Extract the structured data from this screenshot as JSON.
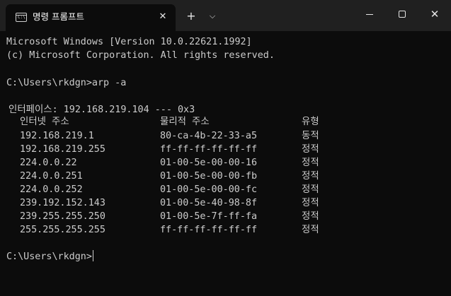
{
  "window": {
    "tab_title": "명령 프롬프트",
    "tab_close_glyph": "✕",
    "new_tab_glyph": "+",
    "dropdown_glyph": "⌵",
    "tab_icon_prompt": "C:\\",
    "close_glyph": "✕",
    "icons": [
      "console-app-icon",
      "close-icon",
      "plus-icon",
      "chevron-down-icon",
      "minimize-icon",
      "maximize-icon",
      "close-icon"
    ]
  },
  "terminal": {
    "header_line1": "Microsoft Windows [Version 10.0.22621.1992]",
    "header_line2": "(c) Microsoft Corporation. All rights reserved.",
    "command_line": "C:\\Users\\rkdgn>arp -a",
    "interface_line": "인터페이스: 192.168.219.104 --- 0x3",
    "columns": {
      "ip": "인터넷 주소",
      "mac": "물리적 주소",
      "type": "유형"
    },
    "rows": [
      {
        "ip": "192.168.219.1",
        "mac": "80-ca-4b-22-33-a5",
        "type": "동적"
      },
      {
        "ip": "192.168.219.255",
        "mac": "ff-ff-ff-ff-ff-ff",
        "type": "정적"
      },
      {
        "ip": "224.0.0.22",
        "mac": "01-00-5e-00-00-16",
        "type": "정적"
      },
      {
        "ip": "224.0.0.251",
        "mac": "01-00-5e-00-00-fb",
        "type": "정적"
      },
      {
        "ip": "224.0.0.252",
        "mac": "01-00-5e-00-00-fc",
        "type": "정적"
      },
      {
        "ip": "239.192.152.143",
        "mac": "01-00-5e-40-98-8f",
        "type": "정적"
      },
      {
        "ip": "239.255.255.250",
        "mac": "01-00-5e-7f-ff-fa",
        "type": "정적"
      },
      {
        "ip": "255.255.255.255",
        "mac": "ff-ff-ff-ff-ff-ff",
        "type": "정적"
      }
    ],
    "prompt": "C:\\Users\\rkdgn>"
  },
  "colors": {
    "titlebar_bg": "#202020",
    "terminal_bg": "#0c0c0c",
    "text": "#cccccc"
  }
}
